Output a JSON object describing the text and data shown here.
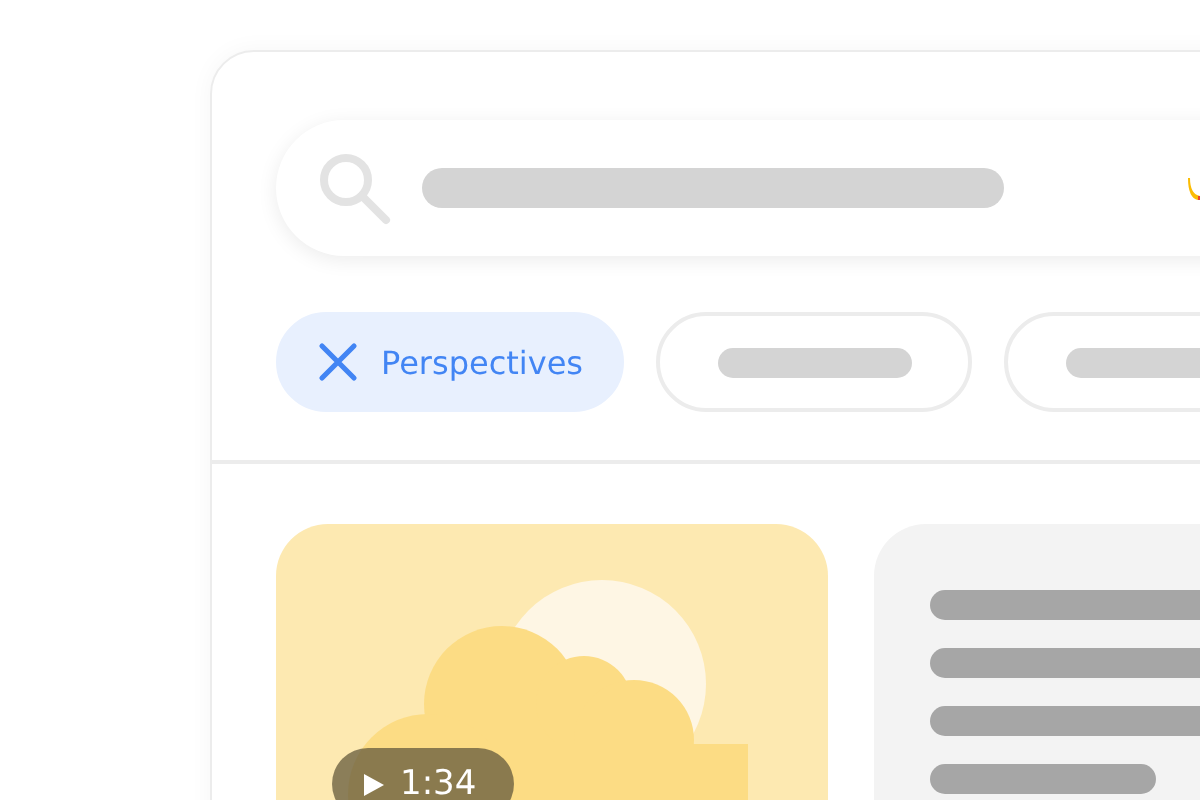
{
  "filter_chips": [
    {
      "label": "Perspectives",
      "selected": true
    },
    {
      "selected": false
    },
    {
      "selected": false
    }
  ],
  "video": {
    "duration": "1:34"
  }
}
